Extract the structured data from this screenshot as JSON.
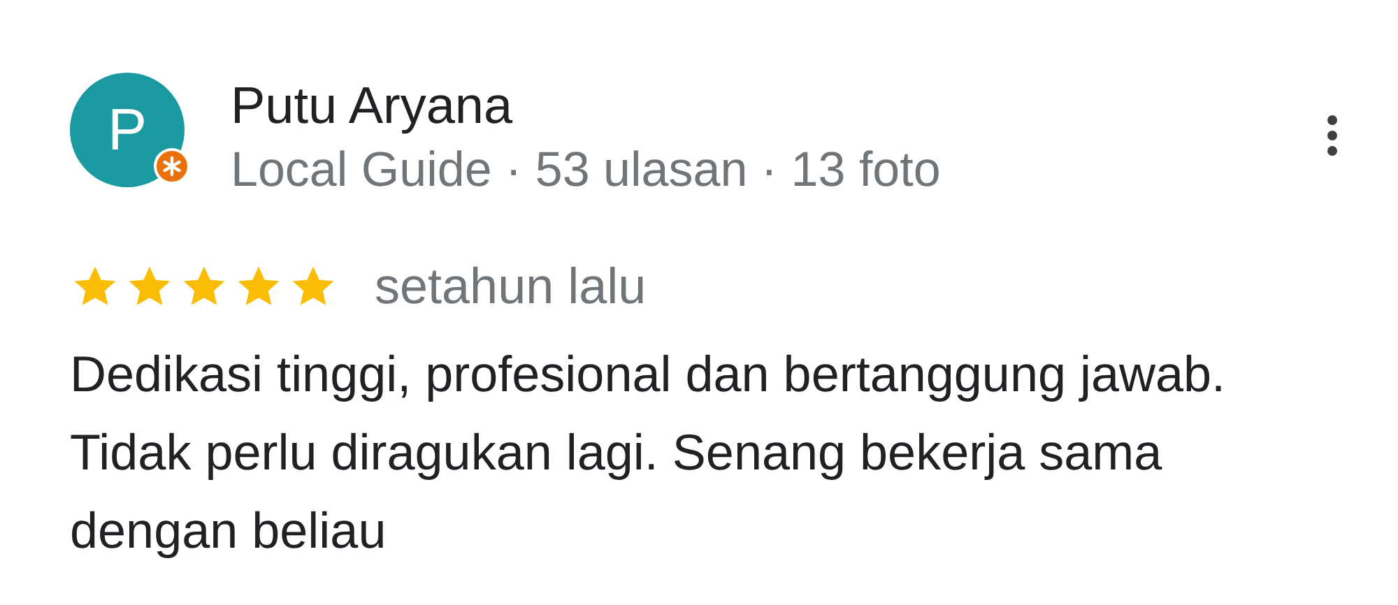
{
  "review": {
    "avatar_letter": "P",
    "local_guide_badge": true,
    "name": "Putu Aryana",
    "subtitle": "Local Guide · 53 ulasan · 13 foto",
    "stars": 5,
    "time": "setahun lalu",
    "text": "Dedikasi tinggi, profesional dan bertanggung jawab. Tidak perlu diragukan lagi. Senang bekerja sama dengan beliau"
  }
}
